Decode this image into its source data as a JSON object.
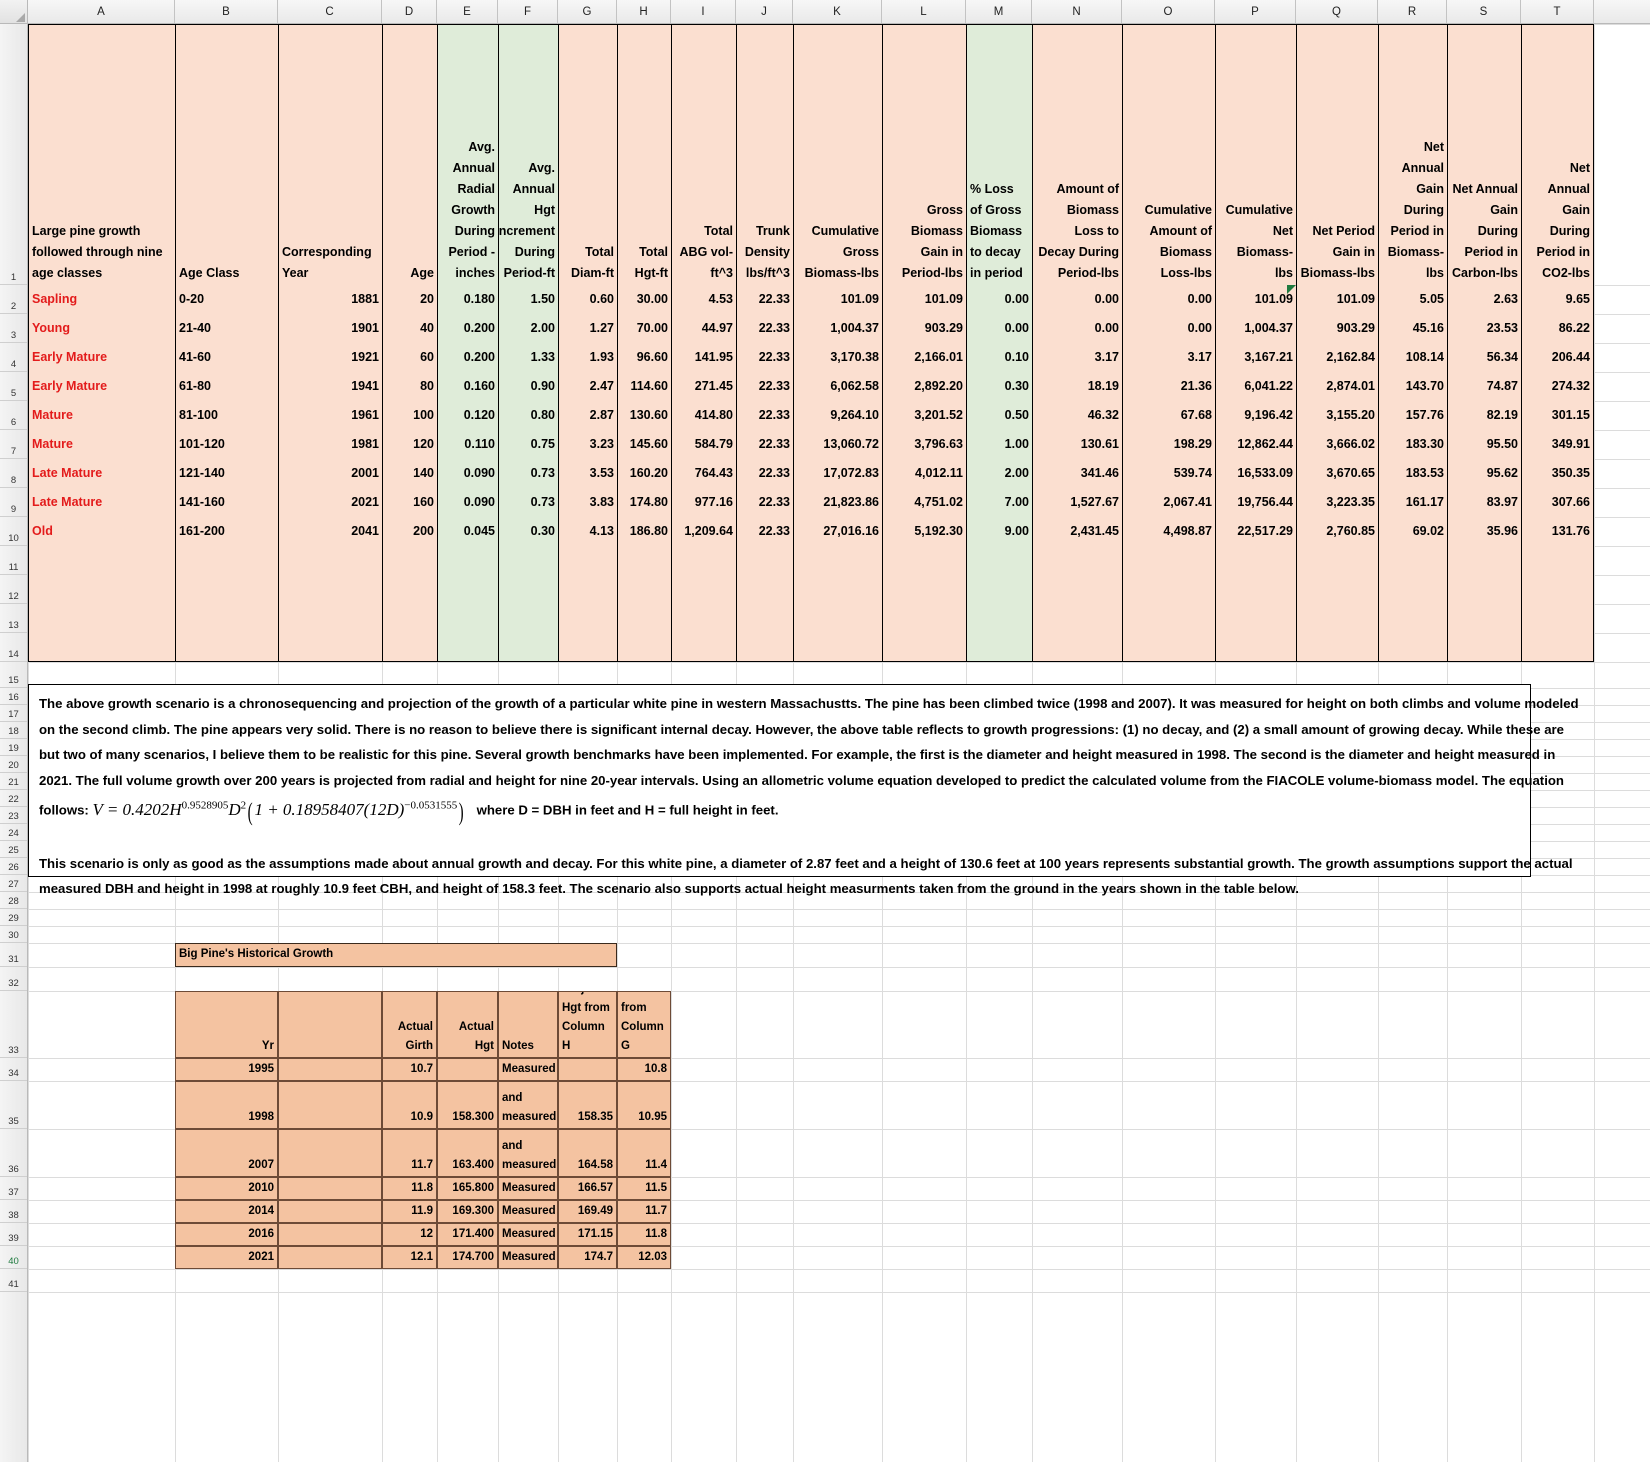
{
  "app": {
    "type": "spreadsheet"
  },
  "columns": {
    "letters": [
      "A",
      "B",
      "C",
      "D",
      "E",
      "F",
      "G",
      "H",
      "I",
      "J",
      "K",
      "L",
      "M",
      "N",
      "O",
      "P",
      "Q",
      "R",
      "S",
      "T"
    ]
  },
  "rows": {
    "numbers": [
      "1",
      "2",
      "3",
      "4",
      "5",
      "6",
      "7",
      "8",
      "9",
      "10",
      "11",
      "12",
      "13",
      "14",
      "15",
      "16",
      "17",
      "18",
      "19",
      "20",
      "21",
      "22",
      "23",
      "24",
      "25",
      "26",
      "27",
      "28",
      "29",
      "30",
      "31",
      "32",
      "33",
      "34",
      "35",
      "36",
      "37",
      "38",
      "39",
      "40",
      "41"
    ]
  },
  "main_table": {
    "headers": [
      "Large pine growth followed through nine age classes",
      "Age Class",
      "Corresponding Year",
      "Age",
      "Avg. Annual Radial Growth During Period - inches",
      "Avg. Annual Hgt increment During Period-ft",
      "Total Diam-ft",
      "Total Hgt-ft",
      "Total ABG vol-ft^3",
      "Trunk Density lbs/ft^3",
      "Cumulative Gross Biomass-lbs",
      "Gross Biomass Gain in Period-lbs",
      "% Loss of Gross Biomass to decay in period",
      "Amount of Biomass Loss to Decay During Period-lbs",
      "Cumulative Amount of Biomass Loss-lbs",
      "Cumulative Net Biomass-lbs",
      "Net Period Gain in Biomass-lbs",
      "Net Annual Gain During Period in Biomass-lbs",
      "Net Annual Gain During Period in Carbon-lbs",
      "Net Annual Gain During Period in CO2-lbs"
    ],
    "rows": [
      {
        "row": "2",
        "class": "Sapling",
        "age_class": "0-20",
        "year": "1881",
        "age": "20",
        "radial": "0.180",
        "hgt_inc": "1.50",
        "diam": "0.60",
        "hgt": "30.00",
        "vol": "4.53",
        "density": "22.33",
        "cum_biomass": "101.09",
        "gross_gain": "101.09",
        "pct_loss": "0.00",
        "decay_period": "0.00",
        "cum_loss": "0.00",
        "cum_net": "101.09",
        "net_period": "101.09",
        "net_annual_biomass": "5.05",
        "net_annual_carbon": "2.63",
        "net_annual_co2": "9.65"
      },
      {
        "row": "3",
        "class": "Young",
        "age_class": "21-40",
        "year": "1901",
        "age": "40",
        "radial": "0.200",
        "hgt_inc": "2.00",
        "diam": "1.27",
        "hgt": "70.00",
        "vol": "44.97",
        "density": "22.33",
        "cum_biomass": "1,004.37",
        "gross_gain": "903.29",
        "pct_loss": "0.00",
        "decay_period": "0.00",
        "cum_loss": "0.00",
        "cum_net": "1,004.37",
        "net_period": "903.29",
        "net_annual_biomass": "45.16",
        "net_annual_carbon": "23.53",
        "net_annual_co2": "86.22"
      },
      {
        "row": "4",
        "class": "Early Mature",
        "age_class": "41-60",
        "year": "1921",
        "age": "60",
        "radial": "0.200",
        "hgt_inc": "1.33",
        "diam": "1.93",
        "hgt": "96.60",
        "vol": "141.95",
        "density": "22.33",
        "cum_biomass": "3,170.38",
        "gross_gain": "2,166.01",
        "pct_loss": "0.10",
        "decay_period": "3.17",
        "cum_loss": "3.17",
        "cum_net": "3,167.21",
        "net_period": "2,162.84",
        "net_annual_biomass": "108.14",
        "net_annual_carbon": "56.34",
        "net_annual_co2": "206.44"
      },
      {
        "row": "5",
        "class": "Early Mature",
        "age_class": "61-80",
        "year": "1941",
        "age": "80",
        "radial": "0.160",
        "hgt_inc": "0.90",
        "diam": "2.47",
        "hgt": "114.60",
        "vol": "271.45",
        "density": "22.33",
        "cum_biomass": "6,062.58",
        "gross_gain": "2,892.20",
        "pct_loss": "0.30",
        "decay_period": "18.19",
        "cum_loss": "21.36",
        "cum_net": "6,041.22",
        "net_period": "2,874.01",
        "net_annual_biomass": "143.70",
        "net_annual_carbon": "74.87",
        "net_annual_co2": "274.32"
      },
      {
        "row": "6",
        "class": "Mature",
        "age_class": "81-100",
        "year": "1961",
        "age": "100",
        "radial": "0.120",
        "hgt_inc": "0.80",
        "diam": "2.87",
        "hgt": "130.60",
        "vol": "414.80",
        "density": "22.33",
        "cum_biomass": "9,264.10",
        "gross_gain": "3,201.52",
        "pct_loss": "0.50",
        "decay_period": "46.32",
        "cum_loss": "67.68",
        "cum_net": "9,196.42",
        "net_period": "3,155.20",
        "net_annual_biomass": "157.76",
        "net_annual_carbon": "82.19",
        "net_annual_co2": "301.15"
      },
      {
        "row": "7",
        "class": "Mature",
        "age_class": "101-120",
        "year": "1981",
        "age": "120",
        "radial": "0.110",
        "hgt_inc": "0.75",
        "diam": "3.23",
        "hgt": "145.60",
        "vol": "584.79",
        "density": "22.33",
        "cum_biomass": "13,060.72",
        "gross_gain": "3,796.63",
        "pct_loss": "1.00",
        "decay_period": "130.61",
        "cum_loss": "198.29",
        "cum_net": "12,862.44",
        "net_period": "3,666.02",
        "net_annual_biomass": "183.30",
        "net_annual_carbon": "95.50",
        "net_annual_co2": "349.91"
      },
      {
        "row": "8",
        "class": "Late Mature",
        "age_class": "121-140",
        "year": "2001",
        "age": "140",
        "radial": "0.090",
        "hgt_inc": "0.73",
        "diam": "3.53",
        "hgt": "160.20",
        "vol": "764.43",
        "density": "22.33",
        "cum_biomass": "17,072.83",
        "gross_gain": "4,012.11",
        "pct_loss": "2.00",
        "decay_period": "341.46",
        "cum_loss": "539.74",
        "cum_net": "16,533.09",
        "net_period": "3,670.65",
        "net_annual_biomass": "183.53",
        "net_annual_carbon": "95.62",
        "net_annual_co2": "350.35"
      },
      {
        "row": "9",
        "class": "Late Mature",
        "age_class": "141-160",
        "year": "2021",
        "age": "160",
        "radial": "0.090",
        "hgt_inc": "0.73",
        "diam": "3.83",
        "hgt": "174.80",
        "vol": "977.16",
        "density": "22.33",
        "cum_biomass": "21,823.86",
        "gross_gain": "4,751.02",
        "pct_loss": "7.00",
        "decay_period": "1,527.67",
        "cum_loss": "2,067.41",
        "cum_net": "19,756.44",
        "net_period": "3,223.35",
        "net_annual_biomass": "161.17",
        "net_annual_carbon": "83.97",
        "net_annual_co2": "307.66"
      },
      {
        "row": "10",
        "class": "Old",
        "age_class": "161-200",
        "year": "2041",
        "age": "200",
        "radial": "0.045",
        "hgt_inc": "0.30",
        "diam": "4.13",
        "hgt": "186.80",
        "vol": "1,209.64",
        "density": "22.33",
        "cum_biomass": "27,016.16",
        "gross_gain": "5,192.30",
        "pct_loss": "9.00",
        "decay_period": "2,431.45",
        "cum_loss": "4,498.87",
        "cum_net": "22,517.29",
        "net_period": "2,760.85",
        "net_annual_biomass": "69.02",
        "net_annual_carbon": "35.96",
        "net_annual_co2": "131.76"
      }
    ]
  },
  "notes": {
    "paragraph1": [
      "The above growth scenario is a chronosequencing and projection of the growth of a particular white pine in western Massachustts. The pine has been climbed twice (1998 and 2007). It was measured for height on both climbs and volume modeled",
      "on the second climb.  The pine appears very solid. There is no reason to believe there is significant internal decay. However, the above table reflects to growth progressions: (1) no decay, and (2) a small amount of growing decay.  While these are",
      "but two of many scenarios, I believe them to be realistic for this pine. Several growth benchmarks have been implemented. For example, the first is the diameter and height measured in 1998. The second is the diameter and height measured in",
      "2021. The full volume growth over 200 years is projected from radial and height for nine 20-year intervals. Using an allometric volume equation developed to predict the calculated volume from the FIACOLE volume-biomass model. The equation"
    ],
    "formula_lead": "follows:",
    "formula_plain": "V = 0.4202H^0.9528905 D^2(1 + 0.18958407(12D)^-0.0531555)",
    "formula_tail": "where D = DBH in feet and H = full height in feet.",
    "paragraph2": [
      "This scenario is only as good as the assumptions made about annual growth and decay. For this white pine, a diameter of 2.87 feet and a height of 130.6 feet at 100 years represents substantial growth.  The growth assumptions support the actual",
      "measured DBH and height in 1998 at roughly 10.9 feet CBH, and height of 158.3 feet. The scenario also supports actual height measurments taken from the ground in the years shown in the table below."
    ]
  },
  "history_table": {
    "title": "Big Pine's Historical Growth",
    "headers": [
      "Yr",
      "",
      "Actual Girth",
      "Actual Hgt",
      "Notes",
      "Projected Hgt from Column H",
      "Projected DBH from Column G",
      ""
    ],
    "rows": [
      {
        "row": "34",
        "yr": "1995",
        "blank": "",
        "girth": "10.7",
        "hgt": "",
        "notes": "Measured",
        "proj_hgt": "",
        "proj_dbh": "10.8"
      },
      {
        "row": "35",
        "yr": "1998",
        "blank": "",
        "girth": "10.9",
        "hgt": "158.300",
        "notes": "Climbed and measured",
        "proj_hgt": "158.35",
        "proj_dbh": "10.95"
      },
      {
        "row": "36",
        "yr": "2007",
        "blank": "",
        "girth": "11.7",
        "hgt": "163.400",
        "notes": "Climbed and measured",
        "proj_hgt": "164.58",
        "proj_dbh": "11.4"
      },
      {
        "row": "37",
        "yr": "2010",
        "blank": "",
        "girth": "11.8",
        "hgt": "165.800",
        "notes": "Measured",
        "proj_hgt": "166.57",
        "proj_dbh": "11.5"
      },
      {
        "row": "38",
        "yr": "2014",
        "blank": "",
        "girth": "11.9",
        "hgt": "169.300",
        "notes": "Measured",
        "proj_hgt": "169.49",
        "proj_dbh": "11.7"
      },
      {
        "row": "39",
        "yr": "2016",
        "blank": "",
        "girth": "12",
        "hgt": "171.400",
        "notes": "Measured",
        "proj_hgt": "171.15",
        "proj_dbh": "11.8"
      },
      {
        "row": "40",
        "yr": "2021",
        "blank": "",
        "girth": "12.1",
        "hgt": "174.700",
        "notes": "Measured",
        "proj_hgt": "174.7",
        "proj_dbh": "12.03"
      }
    ]
  },
  "colors": {
    "fill_peach": "#fbdfd0",
    "fill_green": "#dfecd9",
    "fill_tan": "#f4c3a1",
    "text_red": "#e31b1b",
    "grid": "#dcdcdc"
  }
}
